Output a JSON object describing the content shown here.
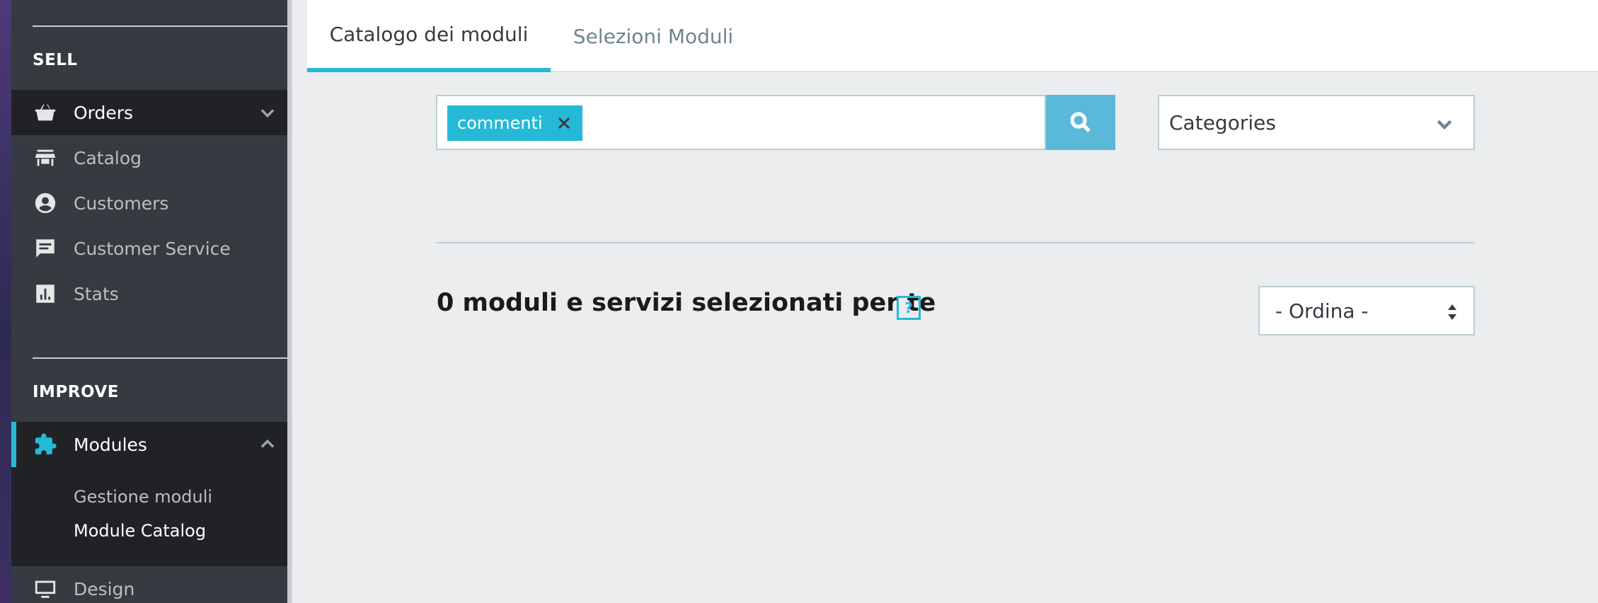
{
  "sidebar": {
    "sell_title": "SELL",
    "improve_title": "IMPROVE",
    "items": [
      {
        "label": "Orders",
        "icon": "basket-icon"
      },
      {
        "label": "Catalog",
        "icon": "store-icon"
      },
      {
        "label": "Customers",
        "icon": "user-circle-icon"
      },
      {
        "label": "Customer Service",
        "icon": "chat-icon"
      },
      {
        "label": "Stats",
        "icon": "bar-chart-icon"
      },
      {
        "label": "Modules",
        "icon": "puzzle-icon"
      },
      {
        "label": "Design",
        "icon": "monitor-icon"
      }
    ],
    "modules_sub": [
      {
        "label": "Gestione moduli"
      },
      {
        "label": "Module Catalog"
      }
    ]
  },
  "tabs": [
    {
      "label": "Catalogo dei moduli",
      "active": true
    },
    {
      "label": "Selezioni Moduli",
      "active": false
    }
  ],
  "search": {
    "tag": "commenti"
  },
  "categories": {
    "selected": "Categories"
  },
  "results": {
    "title": "0 moduli e servizi selezionati per te",
    "help": "?"
  },
  "sort": {
    "selected": "- Ordina -"
  },
  "colors": {
    "accent": "#25b9d7",
    "sidebar_bg": "#363a41",
    "sidebar_active_bg": "#202226"
  }
}
